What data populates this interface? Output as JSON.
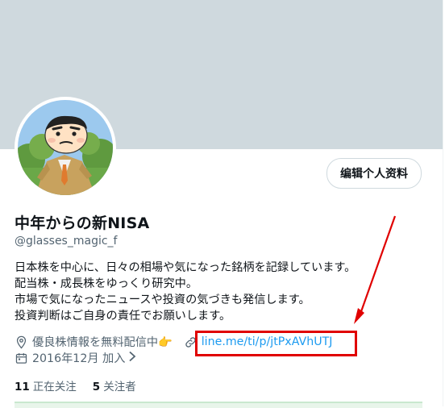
{
  "profile": {
    "name": "中年からの新NISA",
    "handle": "@glasses_magic_f",
    "edit_button": "编辑个人资料",
    "bio_lines": [
      "日本株を中心に、日々の相場や気になった銘柄を記録しています。",
      "配当株・成長株をゆっくり研究中。",
      "市場で気になったニュースや投資の気づきも発信します。",
      "投資判断はご自身の責任でお願いします。"
    ],
    "location": "優良株情報を無料配信中👉",
    "link": "line.me/ti/p/jtPxAVhUTJ",
    "joined": "2016年12月 加入"
  },
  "stats": {
    "following_count": "11",
    "following_label": "正在关注",
    "followers_count": "5",
    "followers_label": "关注者"
  },
  "colors": {
    "banner": "#cfd9de",
    "link": "#1d9bf0",
    "annotation": "#e00000",
    "muted_text": "#536471"
  }
}
